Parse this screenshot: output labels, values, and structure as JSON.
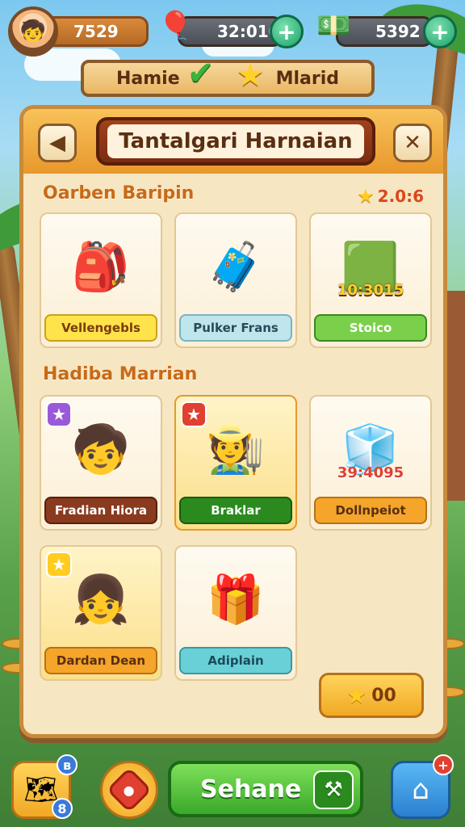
{
  "topbar": {
    "score": "7529",
    "timer": "32:010",
    "cash": "5392",
    "avatar_icon": "boy-avatar-icon",
    "heart_icon": "heart-balloon-icon",
    "cash_icon": "cash-stack-icon"
  },
  "modebar": {
    "left_label": "Hamie",
    "right_label": "Mlarid"
  },
  "panel": {
    "title": "Tantalgari Harnaian",
    "section1": {
      "title": "Oarben Baripin",
      "rating": "2.0:6",
      "cards": [
        {
          "label": "Vellengebls",
          "label_bg": "#ffe34a",
          "label_color": "#7a3c0c",
          "art": "🎒",
          "badge": ""
        },
        {
          "label": "Pulker Frans",
          "label_bg": "#bfe6ec",
          "label_color": "#2a4a5a",
          "art": "🧳",
          "badge": ""
        },
        {
          "label": "Stoico",
          "label_bg": "#7ad04a",
          "label_color": "#ffffff",
          "art": "🟩",
          "overlay": "10:3015"
        }
      ]
    },
    "section2": {
      "title": "Hadiba Marrian",
      "cards": [
        {
          "label": "Fradian Hiora",
          "label_bg": "#8a3a1e",
          "label_color": "#ffffff",
          "art": "🧒",
          "badge": "★",
          "badge_bg": "#9a5ad8"
        },
        {
          "label": "Braklar",
          "label_bg": "#2a8a1e",
          "label_color": "#ffffff",
          "art": "🧑‍🌾",
          "badge": "★",
          "badge_bg": "#e04030"
        },
        {
          "label": "Dollnpeiot",
          "label_bg": "#f4a52a",
          "label_color": "#5a2e12",
          "art": "🧊",
          "overlay": "39:4095"
        },
        {
          "label": "Dardan Dean",
          "label_bg": "#f4a52a",
          "label_color": "#5a2e12",
          "art": "👧",
          "badge": "★",
          "badge_bg": "#ffcc1f"
        },
        {
          "label": "Adiplain",
          "label_bg": "#6ad0d8",
          "label_color": "#1a4a5a",
          "art": "🎁",
          "badge": ""
        }
      ]
    },
    "claim_label": "00"
  },
  "bottombar": {
    "search_label": "Sehane",
    "notif_map": "8",
    "notif_home": "+"
  }
}
